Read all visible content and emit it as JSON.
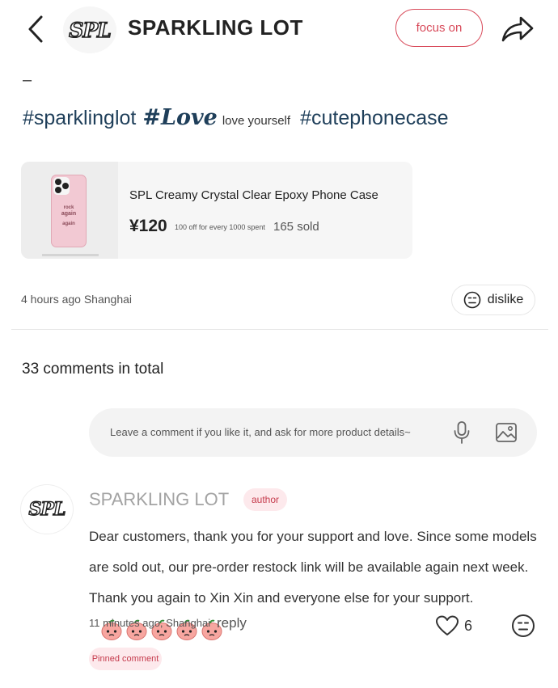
{
  "header": {
    "back_icon": "chevron-left-icon",
    "logo_text": "SPL",
    "brand": "SPARKLING LOT",
    "follow_label": "focus on",
    "share_icon": "share-arrow-icon",
    "accent_color": "#d84a5a"
  },
  "post": {
    "dash": "–",
    "tags": [
      {
        "text": "#sparklinglot"
      },
      {
        "text": "#Love"
      },
      {
        "text": "love yourself"
      },
      {
        "text": "#cutephonecase"
      }
    ]
  },
  "product": {
    "thumb_text": [
      "rock",
      "again",
      "again"
    ],
    "title": "SPL Creamy Crystal Clear Epoxy Phone Case",
    "price": "¥120",
    "promo": "100 off for every 1000 spent",
    "sold": "165 sold"
  },
  "meta": {
    "time_location": "4 hours ago Shanghai",
    "dislike_label": "dislike"
  },
  "comments": {
    "total_label": "33 comments in total",
    "input_placeholder": "Leave a comment if you like it, and ask for more product details~",
    "items": [
      {
        "avatar_text": "SPL",
        "name": "SPARKLING LOT",
        "badge": "author",
        "text": "Dear customers, thank you for your support and love. Since some models are sold out, our pre-order restock link will be available again next week. Thank you again to Xin Xin and everyone else for your support.",
        "emoji_icons": [
          "peach-emoji-icon",
          "peach-emoji-icon",
          "peach-emoji-icon",
          "peach-emoji-icon",
          "peach-emoji-icon"
        ],
        "time_location": "11 minutes ago, Shanghai",
        "reply_label": "reply",
        "likes": "6",
        "pinned_label": "Pinned comment"
      }
    ]
  }
}
